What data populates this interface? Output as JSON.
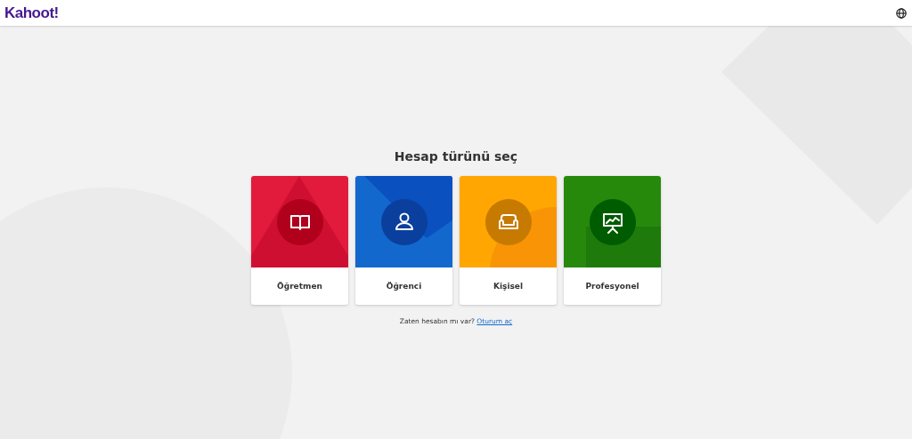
{
  "header": {
    "logo": "Kahoot!"
  },
  "title": "Hesap türünü seç",
  "account_types": [
    {
      "label": "Öğretmen",
      "kind": "book",
      "color": "#e21b3c"
    },
    {
      "label": "Öğrenci",
      "kind": "person",
      "color": "#1368ce"
    },
    {
      "label": "Kişisel",
      "kind": "sofa",
      "color": "#ffa602"
    },
    {
      "label": "Profesyonel",
      "kind": "presentation",
      "color": "#26890c"
    }
  ],
  "login_prompt": {
    "text": "Zaten hesabın mı var?",
    "link": "Oturum aç"
  }
}
